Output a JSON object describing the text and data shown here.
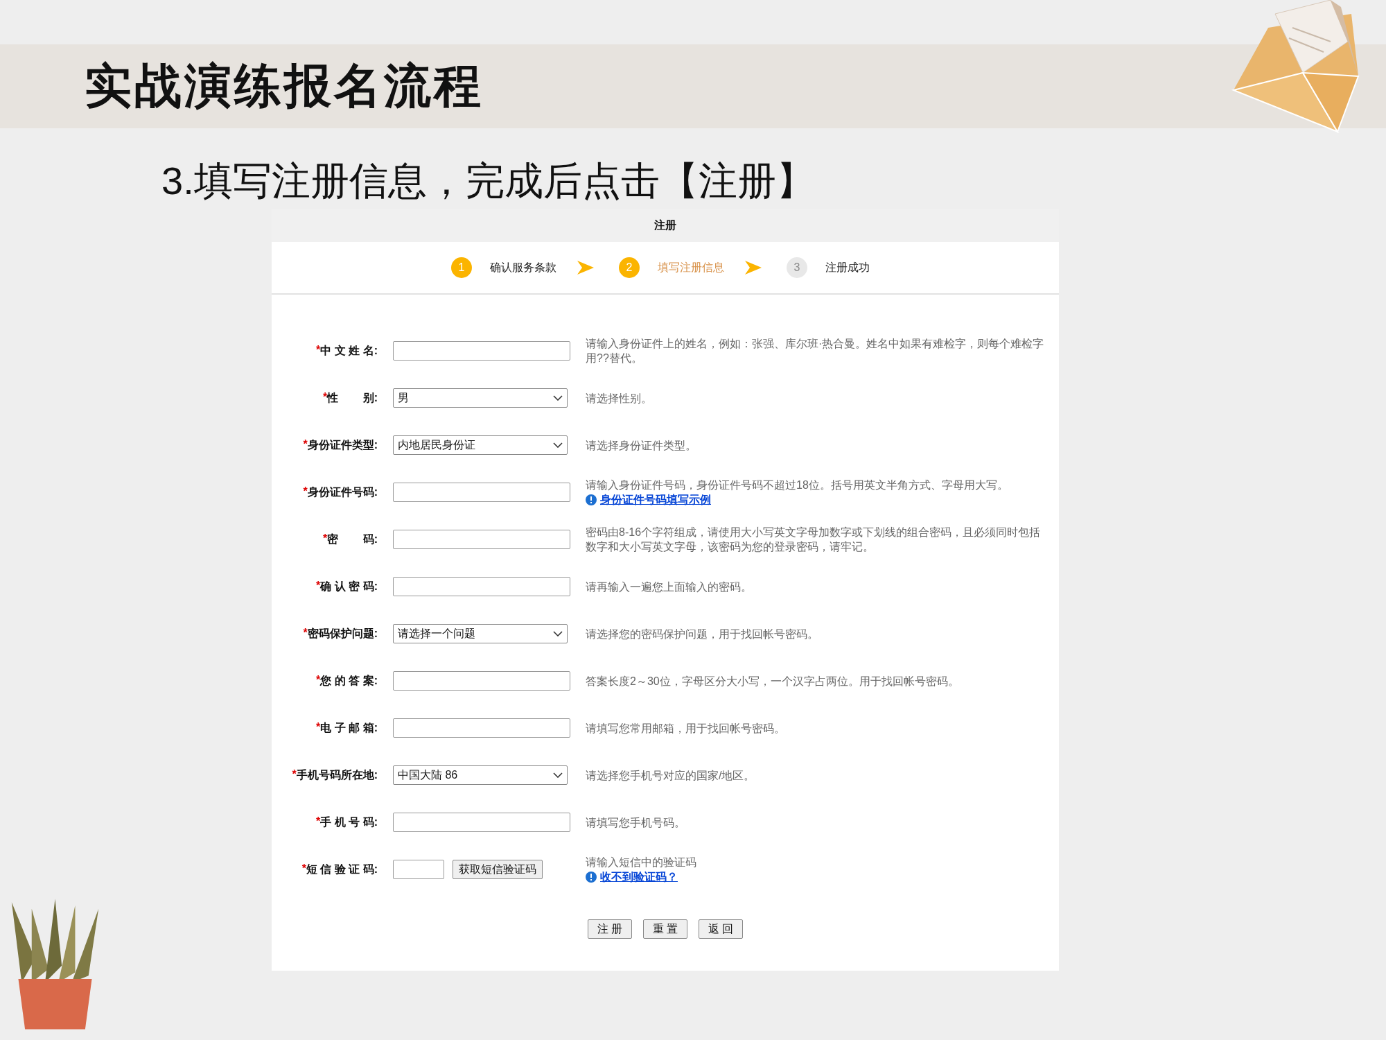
{
  "slide": {
    "title": "实战演练报名流程",
    "subtitle": "3.填写注册信息，完成后点击【注册】"
  },
  "form": {
    "header": "注册",
    "steps": [
      {
        "number": "1",
        "label": "确认服务条款",
        "reached": true,
        "selected": false
      },
      {
        "number": "2",
        "label": "填写注册信息",
        "reached": true,
        "selected": true
      },
      {
        "number": "3",
        "label": "注册成功",
        "reached": false,
        "selected": false
      }
    ],
    "fields": [
      {
        "kind": "text",
        "mark": "*",
        "label": "中 文 姓 名:",
        "hint": "请输入身份证件上的姓名，例如：张强、库尔班·热合曼。姓名中如果有难检字，则每个难检字用??替代。"
      },
      {
        "kind": "select",
        "mark": "*",
        "label": "性        别:",
        "value": "男",
        "hint": "请选择性别。"
      },
      {
        "kind": "select",
        "mark": "*",
        "label": "身份证件类型:",
        "value": "内地居民身份证",
        "hint": "请选择身份证件类型。"
      },
      {
        "kind": "text",
        "mark": "*",
        "label": "身份证件号码:",
        "hint": "请输入身份证件号码，身份证件号码不超过18位。括号用英文半角方式、字母用大写。",
        "link": "身份证件号码填写示例"
      },
      {
        "kind": "text",
        "mark": "*",
        "label": "密        码:",
        "hint": "密码由8-16个字符组成，请使用大小写英文字母加数字或下划线的组合密码，且必须同时包括数字和大小写英文字母，该密码为您的登录密码，请牢记。"
      },
      {
        "kind": "text",
        "mark": "*",
        "label": "确 认 密 码:",
        "hint": "请再输入一遍您上面输入的密码。"
      },
      {
        "kind": "select",
        "mark": "*",
        "label": "密码保护问题:",
        "value": "请选择一个问题",
        "hint": "请选择您的密码保护问题，用于找回帐号密码。"
      },
      {
        "kind": "text",
        "mark": "*",
        "label": "您 的 答 案:",
        "hint": "答案长度2～30位，字母区分大小写，一个汉字占两位。用于找回帐号密码。"
      },
      {
        "kind": "text",
        "mark": "*",
        "label": "电 子 邮 箱:",
        "hint": "请填写您常用邮箱，用于找回帐号密码。"
      },
      {
        "kind": "select",
        "mark": "*",
        "label": "手机号码所在地:",
        "value": "中国大陆 86",
        "hint": "请选择您手机号对应的国家/地区。"
      },
      {
        "kind": "text",
        "mark": "*",
        "label": "手 机 号 码:",
        "hint": "请填写您手机号码。"
      },
      {
        "kind": "sms",
        "mark": "*",
        "label": "短 信 验 证 码:",
        "button": "获取短信验证码",
        "hint": "请输入短信中的验证码",
        "link": "收不到验证码？"
      }
    ],
    "buttons": [
      "注 册",
      "重 置",
      "返 回"
    ]
  }
}
